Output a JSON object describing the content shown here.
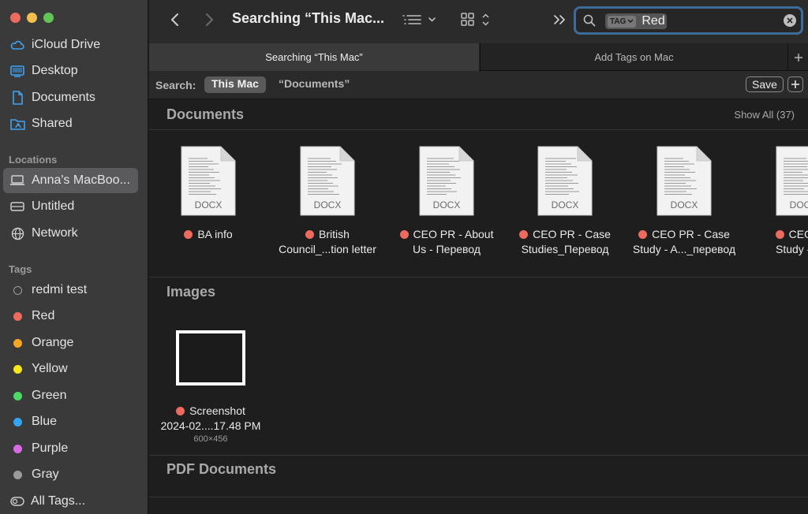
{
  "colors": {
    "red_tag": "#ec6a5e",
    "orange_tag": "#f5a623",
    "yellow_tag": "#f8e71c",
    "green_tag": "#4cd964",
    "blue_tag": "#34a4f4",
    "purple_tag": "#d86ae6",
    "gray_tag": "#9b9b9b",
    "accent": "#3f6b98"
  },
  "sidebar": {
    "favorites": [
      {
        "label": "iCloud Drive",
        "icon": "cloud-icon"
      },
      {
        "label": "Desktop",
        "icon": "desktop-icon"
      },
      {
        "label": "Documents",
        "icon": "document-icon"
      },
      {
        "label": "Shared",
        "icon": "shared-folder-icon"
      }
    ],
    "locations_title": "Locations",
    "locations": [
      {
        "label": "Anna's MacBoo...",
        "icon": "laptop-icon"
      },
      {
        "label": "Untitled",
        "icon": "drive-icon"
      },
      {
        "label": "Network",
        "icon": "globe-icon"
      }
    ],
    "tags_title": "Tags",
    "tags": [
      {
        "label": "redmi test",
        "color": "none"
      },
      {
        "label": "Red",
        "color": "#ec6a5e"
      },
      {
        "label": "Orange",
        "color": "#f5a623"
      },
      {
        "label": "Yellow",
        "color": "#f8e71c"
      },
      {
        "label": "Green",
        "color": "#4cd964"
      },
      {
        "label": "Blue",
        "color": "#34a4f4"
      },
      {
        "label": "Purple",
        "color": "#d86ae6"
      },
      {
        "label": "Gray",
        "color": "#9b9b9b"
      },
      {
        "label": "All Tags...",
        "icon": "all-tags-icon"
      }
    ]
  },
  "toolbar": {
    "title": "Searching “This Mac...",
    "search": {
      "token_kind": "TAG",
      "token_value": "Red"
    }
  },
  "tabs": [
    {
      "label": "Searching “This Mac”"
    },
    {
      "label": "Add Tags on Mac"
    }
  ],
  "scope": {
    "label": "Search:",
    "this_mac": "This Mac",
    "documents": "“Documents”",
    "save": "Save"
  },
  "sections": {
    "documents": {
      "title": "Documents",
      "show_all": "Show All (37)"
    },
    "images": {
      "title": "Images"
    },
    "pdf": {
      "title": "PDF Documents"
    }
  },
  "documents": [
    {
      "line1": "BA info",
      "line2": "",
      "kind": "DOCX"
    },
    {
      "line1": "British",
      "line2": "Council_...tion letter",
      "kind": "DOCX"
    },
    {
      "line1": "CEO PR - About",
      "line2": "Us - Перевод",
      "kind": "DOCX"
    },
    {
      "line1": "CEO PR - Case",
      "line2": "Studies_Перевод",
      "kind": "DOCX"
    },
    {
      "line1": "CEO PR - Case",
      "line2": "Study - A..._перевод",
      "kind": "DOCX"
    },
    {
      "line1": "CEO PR",
      "line2": "Study - C...",
      "kind": "DOCX"
    }
  ],
  "images": [
    {
      "line1": "Screenshot",
      "line2": "2024-02....17.48 PM",
      "dims": "600×456"
    }
  ]
}
